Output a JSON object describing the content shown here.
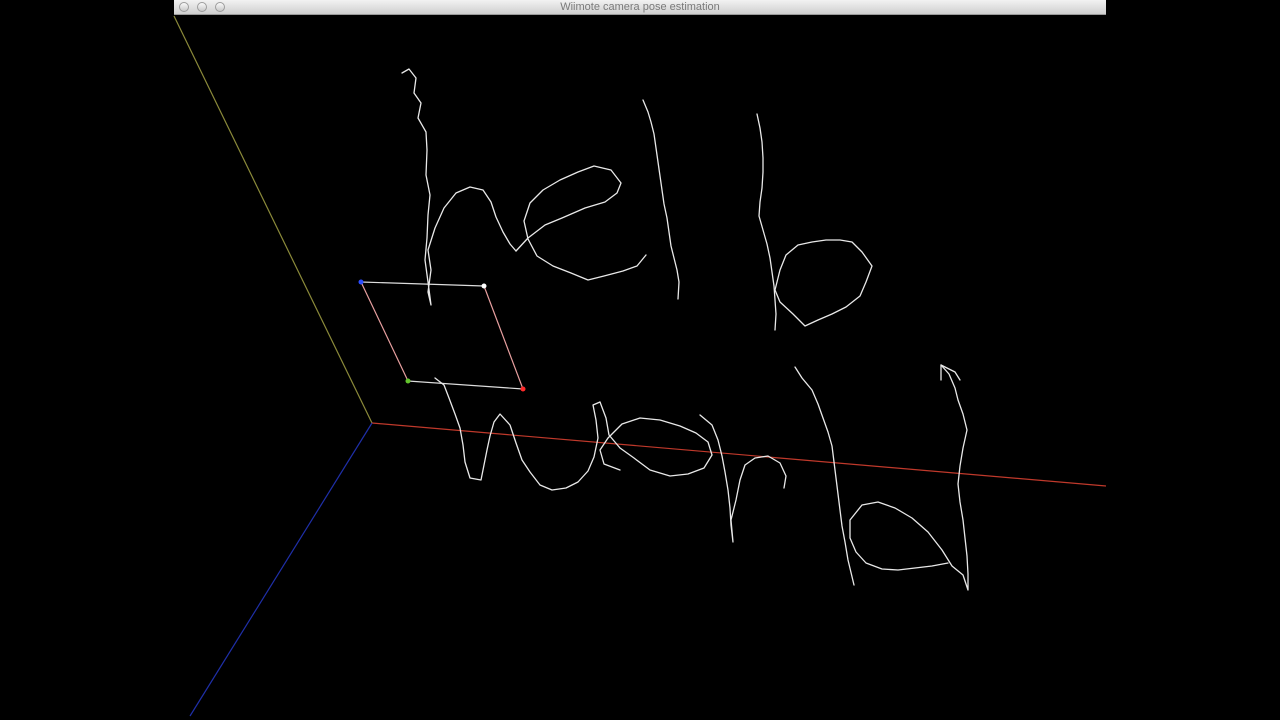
{
  "window": {
    "title": "Wiimote camera pose estimation",
    "buttons": [
      "close",
      "minimize",
      "zoom"
    ]
  },
  "scene": {
    "background": "#000000",
    "axes": [
      {
        "name": "x-axis",
        "color": "#c0392b"
      },
      {
        "name": "y-axis",
        "color": "#8b8a3a"
      },
      {
        "name": "z-axis",
        "color": "#1f2fa8"
      }
    ],
    "handwriting_text": "hello world",
    "camera_marker_colors": [
      "#2b4cff",
      "#ffffff",
      "#ff2a2a",
      "#63c42d"
    ],
    "stroke_color": "#e8e8e8"
  }
}
